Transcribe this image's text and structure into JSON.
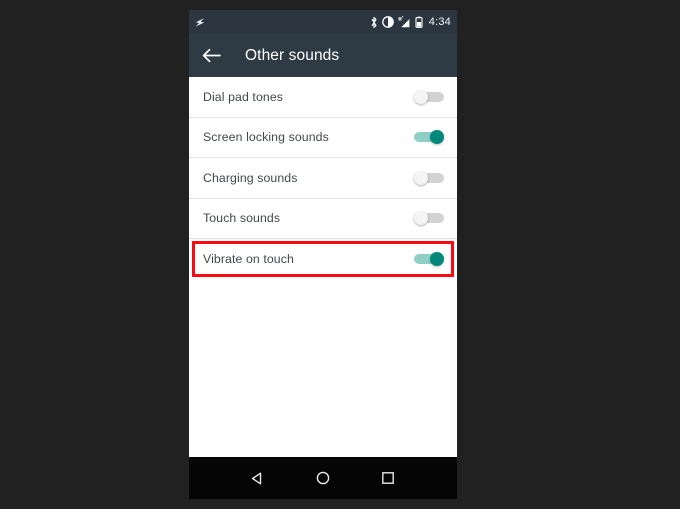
{
  "theme": {
    "page_background": "#212121",
    "status_bar_background": "#2b3640",
    "toolbar_background": "#2e3a44",
    "screen_background": "#ffffff",
    "nav_bar_background": "#050505",
    "accent_on": "#00897b",
    "track_on": "#8fcfc6",
    "track_off": "#d2d2d2",
    "thumb_off": "#f4f4f4",
    "highlight_border": "#fb0a12",
    "row_text": "#43484c",
    "divider": "#e4e4e4"
  },
  "status_bar": {
    "left_icons": [
      "screenshot-flash-icon"
    ],
    "right_icons": [
      "bluetooth-icon",
      "do-not-disturb-icon",
      "signal-bars-icon",
      "battery-icon"
    ],
    "time": "4:34"
  },
  "toolbar": {
    "back_icon": "back-arrow-icon",
    "title": "Other sounds"
  },
  "settings": {
    "rows": [
      {
        "label": "Dial pad tones",
        "state": "off",
        "highlighted": false
      },
      {
        "label": "Screen locking sounds",
        "state": "on",
        "highlighted": false
      },
      {
        "label": "Charging sounds",
        "state": "off",
        "highlighted": false
      },
      {
        "label": "Touch sounds",
        "state": "off",
        "highlighted": false
      },
      {
        "label": "Vibrate on touch",
        "state": "on",
        "highlighted": true
      }
    ]
  },
  "nav_bar": {
    "buttons": [
      {
        "name": "back-nav-button",
        "icon": "triangle-back-icon"
      },
      {
        "name": "home-nav-button",
        "icon": "circle-home-icon"
      },
      {
        "name": "recents-nav-button",
        "icon": "square-recents-icon"
      }
    ]
  }
}
